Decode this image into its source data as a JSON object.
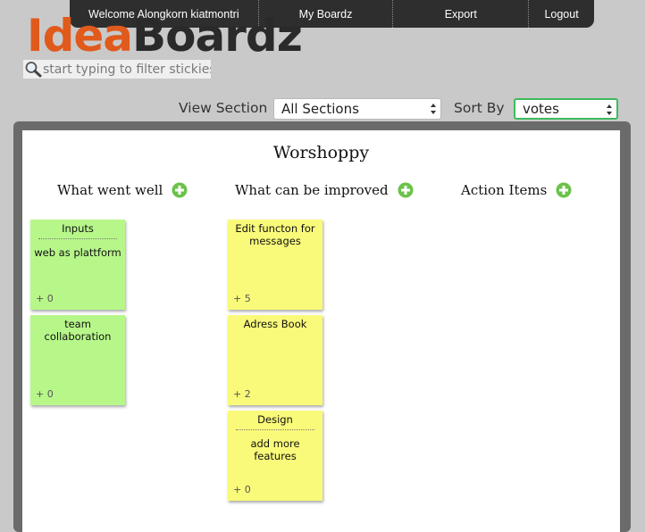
{
  "nav": {
    "welcome": "Welcome Alongkorn kiatmontri",
    "my_boards": "My Boardz",
    "export": "Export",
    "logout": "Logout"
  },
  "logo": {
    "part1": "Idea",
    "part2": "Boardz"
  },
  "filter": {
    "placeholder": "start typing to filter stickies",
    "value": ""
  },
  "controls": {
    "view_section_label": "View Section",
    "view_section_value": "All Sections",
    "sort_by_label": "Sort By",
    "sort_by_value": "votes"
  },
  "board": {
    "title": "Worshoppy",
    "columns": [
      {
        "heading": "What went well"
      },
      {
        "heading": "What can be improved"
      },
      {
        "heading": "Action Items"
      }
    ]
  },
  "stickies": [
    {
      "title": "Inputs",
      "body": "web as plattform",
      "votes": "+ 0",
      "color": "#b7f78a"
    },
    {
      "title": "",
      "body": "team collaboration",
      "votes": "+ 0",
      "color": "#b7f78a"
    },
    {
      "title": "",
      "body": "Edit functon for messages",
      "votes": "+ 5",
      "color": "#fafa7a"
    },
    {
      "title": "",
      "body": "Adress Book",
      "votes": "+ 2",
      "color": "#fafa7a"
    },
    {
      "title": "Design",
      "body": "add more features",
      "votes": "+ 0",
      "color": "#fafa7a"
    }
  ],
  "colors": {
    "accent_green": "#6cc24a",
    "nav_bg": "#2e2e2e",
    "logo_orange": "#e05a1c"
  }
}
